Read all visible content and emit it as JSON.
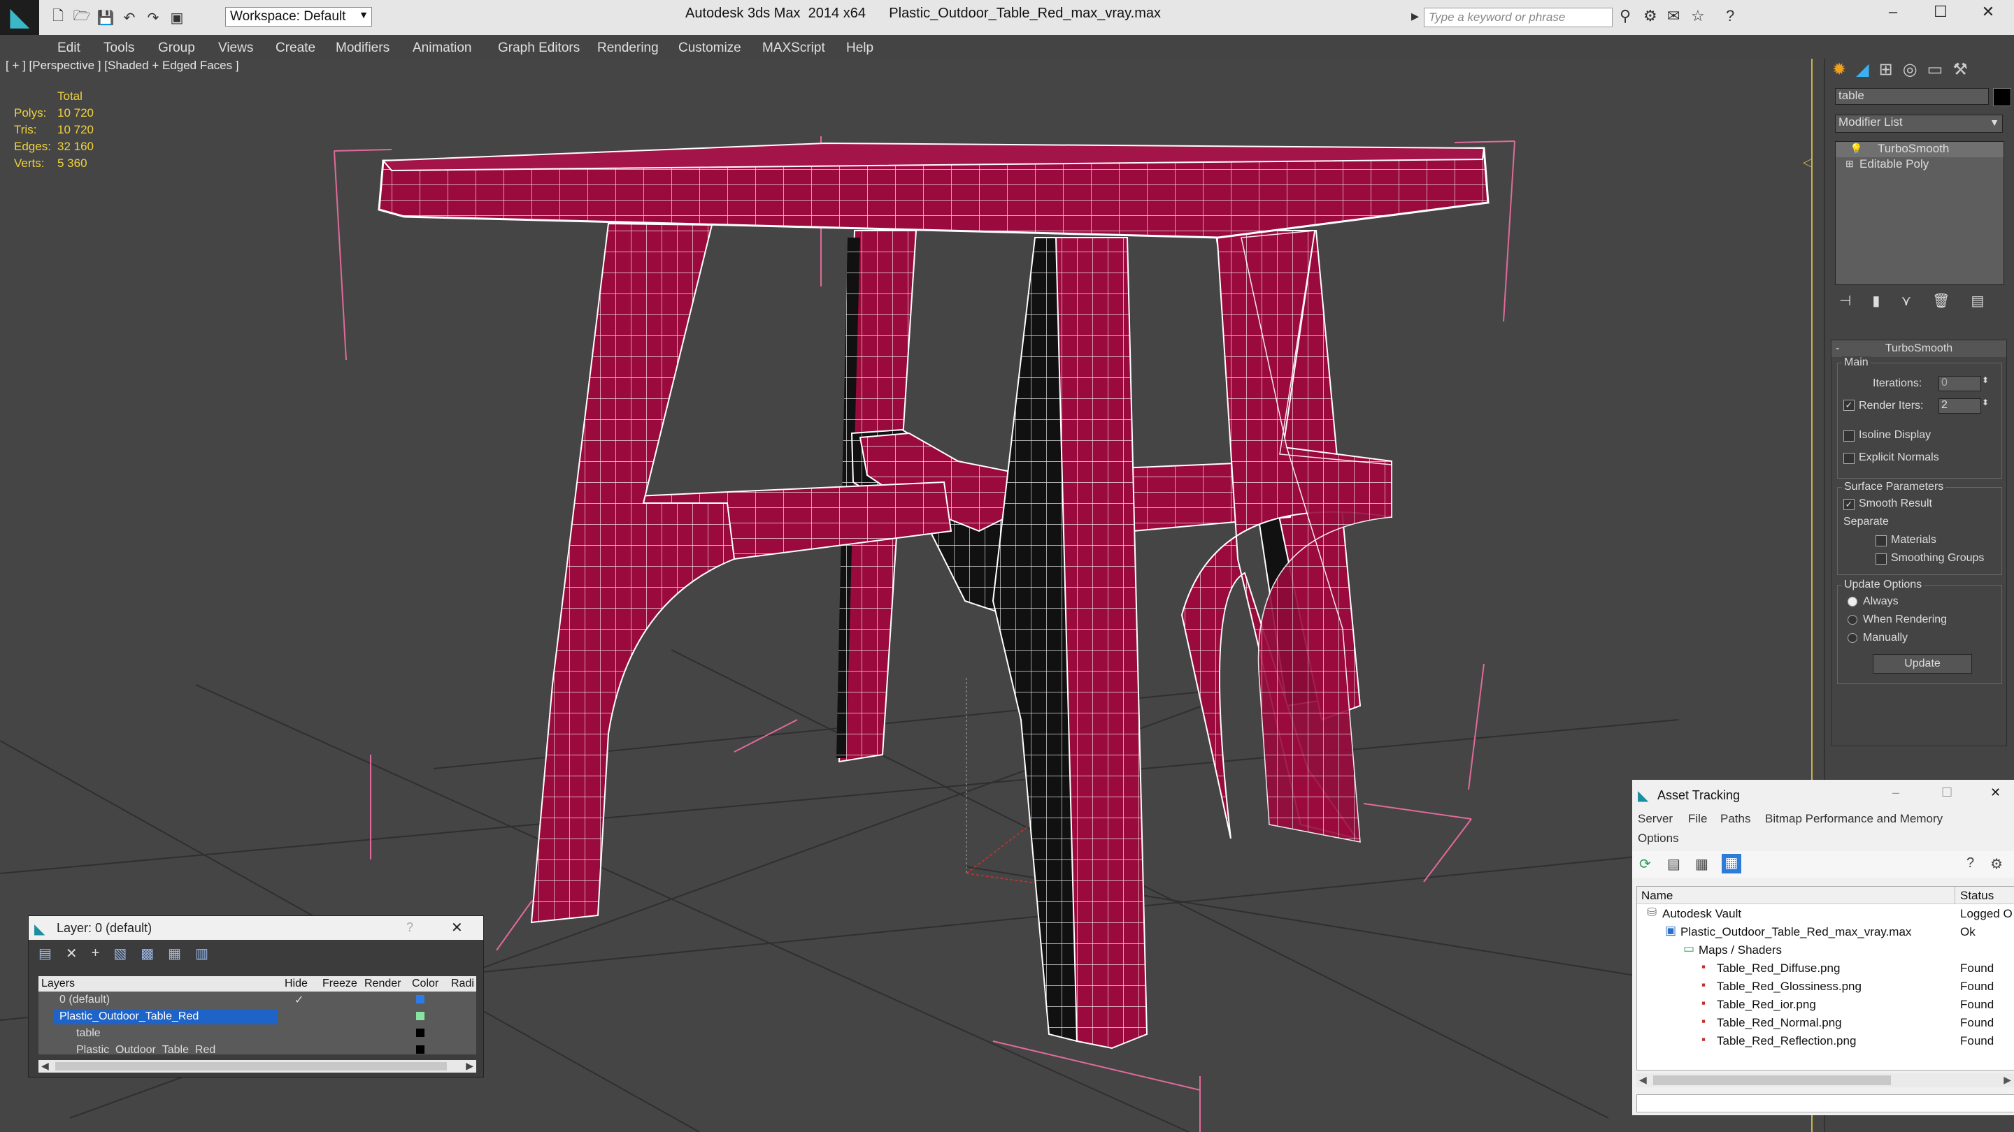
{
  "app": {
    "title": "Autodesk 3ds Max  2014 x64      Plastic_Outdoor_Table_Red_max_vray.max",
    "workspace_label": "Workspace: Default",
    "search_placeholder": "Type a keyword or phrase"
  },
  "menu": [
    "Edit",
    "Tools",
    "Group",
    "Views",
    "Create",
    "Modifiers",
    "Animation",
    "Graph Editors",
    "Rendering",
    "Customize",
    "MAXScript",
    "Help"
  ],
  "viewport": {
    "label": "[ + ] [Perspective ] [Shaded + Edged Faces ]",
    "stats": {
      "header": "Total",
      "rows": [
        {
          "label": "Polys:",
          "value": "10 720"
        },
        {
          "label": "Tris:",
          "value": "10 720"
        },
        {
          "label": "Edges:",
          "value": "32 160"
        },
        {
          "label": "Verts:",
          "value": "5 360"
        }
      ]
    }
  },
  "command_panel": {
    "name_field": "table",
    "modifier_list_label": "Modifier List",
    "stack": [
      "TurboSmooth",
      "Editable Poly"
    ],
    "rollout_title": "TurboSmooth",
    "main_group": "Main",
    "iterations_label": "Iterations:",
    "iterations_value": "0",
    "render_iters_label": "Render Iters:",
    "render_iters_value": "2",
    "isoline_label": "Isoline Display",
    "explicit_normals_label": "Explicit Normals",
    "surface_group": "Surface Parameters",
    "smooth_result_label": "Smooth Result",
    "separate_label": "Separate",
    "materials_label": "Materials",
    "smoothing_groups_label": "Smoothing Groups",
    "update_group": "Update Options",
    "update_always": "Always",
    "update_when_rendering": "When Rendering",
    "update_manually": "Manually",
    "update_button": "Update"
  },
  "layer_window": {
    "title": "Layer: 0 (default)",
    "columns": [
      "Layers",
      "Hide",
      "Freeze",
      "Render",
      "Color",
      "Radi"
    ],
    "rows": [
      {
        "name": "0 (default)",
        "color": "#2e7be8",
        "selected": false,
        "indent": 0
      },
      {
        "name": "Plastic_Outdoor_Table_Red",
        "color": "#86e3a0",
        "selected": true,
        "indent": 0
      },
      {
        "name": "table",
        "color": "#000000",
        "selected": false,
        "indent": 1
      },
      {
        "name": "Plastic_Outdoor_Table_Red",
        "color": "#000000",
        "selected": false,
        "indent": 1
      }
    ]
  },
  "asset_tracking": {
    "title": "Asset Tracking",
    "menu": [
      "Server",
      "File",
      "Paths",
      "Bitmap Performance and Memory"
    ],
    "menu2": "Options",
    "col_name": "Name",
    "col_status": "Status",
    "rows": [
      {
        "name": "Autodesk Vault",
        "status": "Logged O",
        "indent": 0,
        "icon": "vault"
      },
      {
        "name": "Plastic_Outdoor_Table_Red_max_vray.max",
        "status": "Ok",
        "indent": 1,
        "icon": "max"
      },
      {
        "name": "Maps / Shaders",
        "status": "",
        "indent": 2,
        "icon": "folder"
      },
      {
        "name": "Table_Red_Diffuse.png",
        "status": "Found",
        "indent": 3,
        "icon": "png"
      },
      {
        "name": "Table_Red_Glossiness.png",
        "status": "Found",
        "indent": 3,
        "icon": "png"
      },
      {
        "name": "Table_Red_ior.png",
        "status": "Found",
        "indent": 3,
        "icon": "png"
      },
      {
        "name": "Table_Red_Normal.png",
        "status": "Found",
        "indent": 3,
        "icon": "png"
      },
      {
        "name": "Table_Red_Reflection.png",
        "status": "Found",
        "indent": 3,
        "icon": "png"
      }
    ]
  },
  "colors": {
    "model_red": "#9a0a3c",
    "wire": "#ffffff",
    "stats_yellow": "#f0d23c",
    "selection_blue": "#1e64c8"
  }
}
